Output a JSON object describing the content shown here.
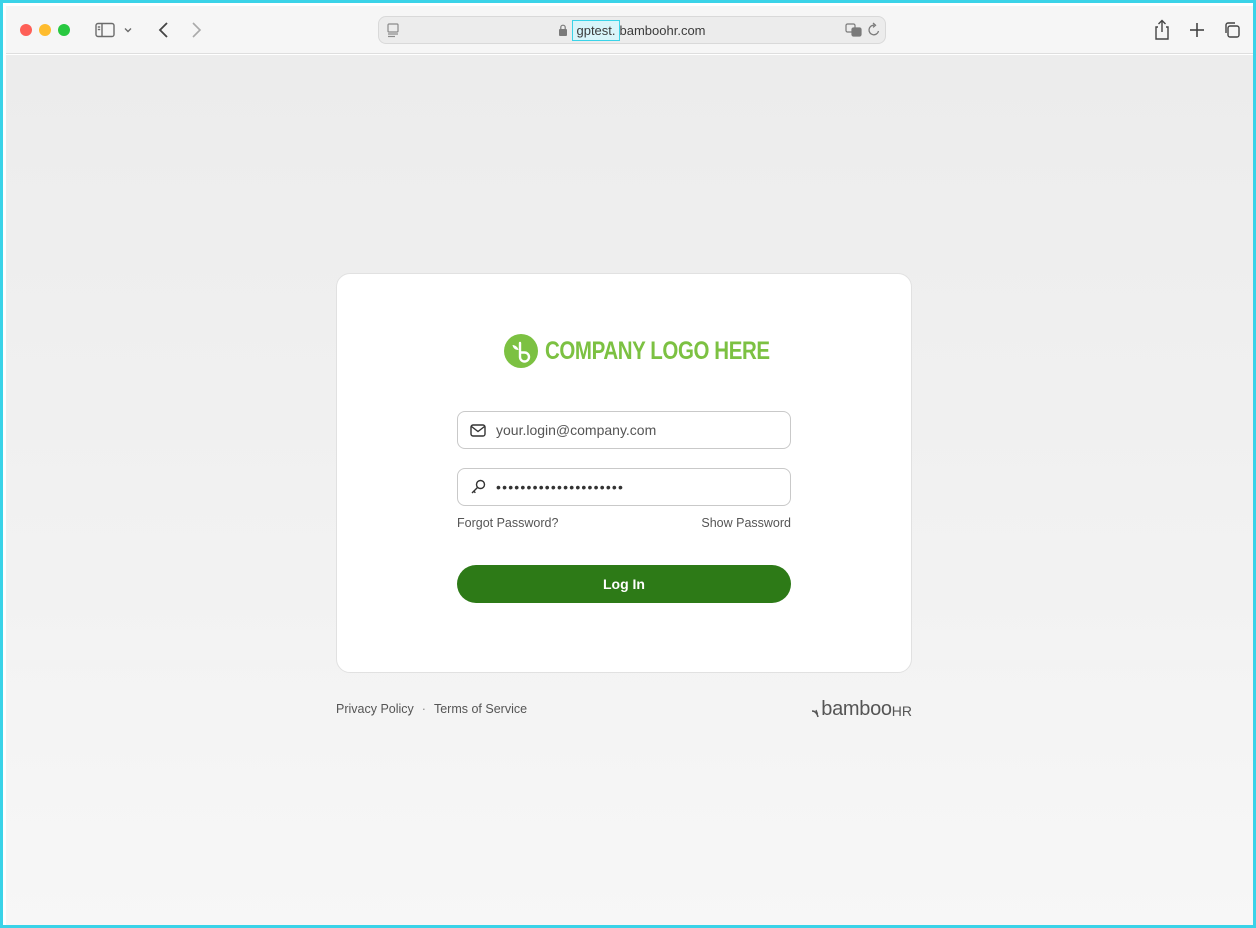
{
  "browser": {
    "url_subdomain": "gptest.",
    "url_domain": "bamboohr.com"
  },
  "login": {
    "logo_text": "COMPANY LOGO HERE",
    "email_placeholder": "your.login@company.com",
    "password_masked": "•••••••••••••••••••••",
    "forgot_password": "Forgot Password?",
    "show_password": "Show Password",
    "login_button": "Log In"
  },
  "footer": {
    "privacy": "Privacy Policy",
    "separator": "·",
    "terms": "Terms of Service",
    "brand_word": "bamboo",
    "brand_hr": "HR"
  },
  "colors": {
    "accent_green": "#2d7a17",
    "logo_green": "#7cc142",
    "highlight": "#3ad3e8"
  }
}
